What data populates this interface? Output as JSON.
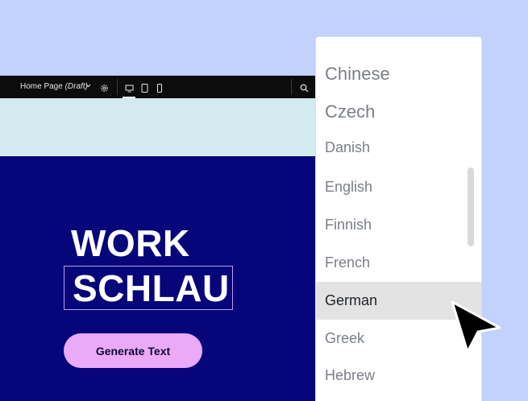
{
  "toolbar": {
    "page_name": "Home Page",
    "page_status": "(Draft)",
    "icons": [
      "chevron-down-icon",
      "gear-icon",
      "desktop-icon",
      "tablet-icon",
      "mobile-icon",
      "search-icon"
    ],
    "active_device": "desktop"
  },
  "hero": {
    "line1": "WORK",
    "line2": "SCHLAU",
    "button_label": "Generate Text",
    "background": "#060579",
    "band_color": "#d3eaee",
    "button_color": "#ebaaf7"
  },
  "language_dropdown": {
    "items": [
      "Chinese",
      "Czech",
      "Danish",
      "English",
      "Finnish",
      "French",
      "German",
      "Greek",
      "Hebrew"
    ],
    "selected": "German"
  },
  "colors": {
    "page_background": "#c3d1fd",
    "toolbar_background": "#0c0c0c",
    "selected_item_background": "#e3e3e3"
  }
}
